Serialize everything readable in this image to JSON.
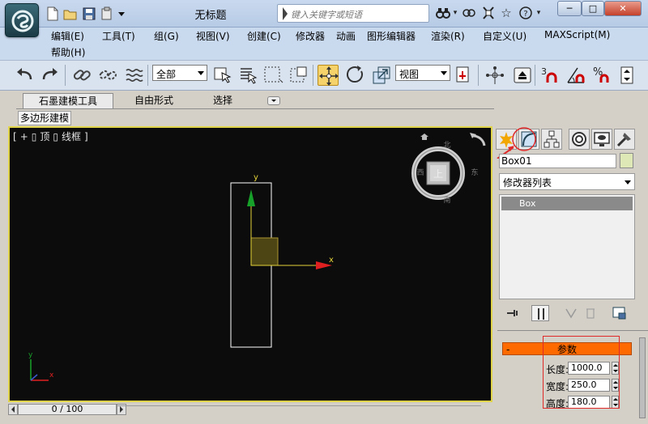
{
  "window": {
    "title": "无标题",
    "search_placeholder": "键入关键字或短语",
    "controls": {
      "minimize": "─",
      "maximize": "□",
      "close": "✕"
    }
  },
  "menu": {
    "items": [
      "编辑(E)",
      "工具(T)",
      "组(G)",
      "视图(V)",
      "创建(C)",
      "修改器",
      "动画",
      "图形编辑器",
      "渲染(R)",
      "自定义(U)",
      "MAXScript(M)",
      "帮助(H)"
    ]
  },
  "toolbar": {
    "selection_filter": "全部",
    "ref_coord": "视图",
    "snap_angle_label": "3",
    "snap_percent_label": "%"
  },
  "ribbon": {
    "tabs": [
      "石墨建模工具",
      "自由形式",
      "选择"
    ],
    "subtab": "多边形建模"
  },
  "viewport": {
    "label_parts": [
      "[",
      "+",
      "▯",
      "顶",
      "▯",
      "线框",
      "]"
    ],
    "viewcube_face": "上",
    "compass": {
      "n": "北",
      "s": "南",
      "e": "东",
      "w": "西"
    },
    "gizmo_labels": {
      "x": "x",
      "y": "y"
    },
    "corner_axes": {
      "x": "x",
      "y": "y"
    }
  },
  "command_panel": {
    "object_name": "Box01",
    "modifier_list_label": "修改器列表",
    "stack_items": [
      "Box"
    ],
    "params": {
      "rollout_title": "参数",
      "collapse_symbol": "-",
      "rows": [
        {
          "label": "长度:",
          "value": "1000.0"
        },
        {
          "label": "宽度:",
          "value": "250.0"
        },
        {
          "label": "高度:",
          "value": "180.0"
        }
      ]
    }
  },
  "timeline": {
    "frame_display": "0 / 100"
  },
  "colors": {
    "viewport_bg": "#0c0c0c",
    "viewport_border": "#e0d44a",
    "rollout_accent": "#ff6a00",
    "annotation_red": "#e02a2a"
  }
}
